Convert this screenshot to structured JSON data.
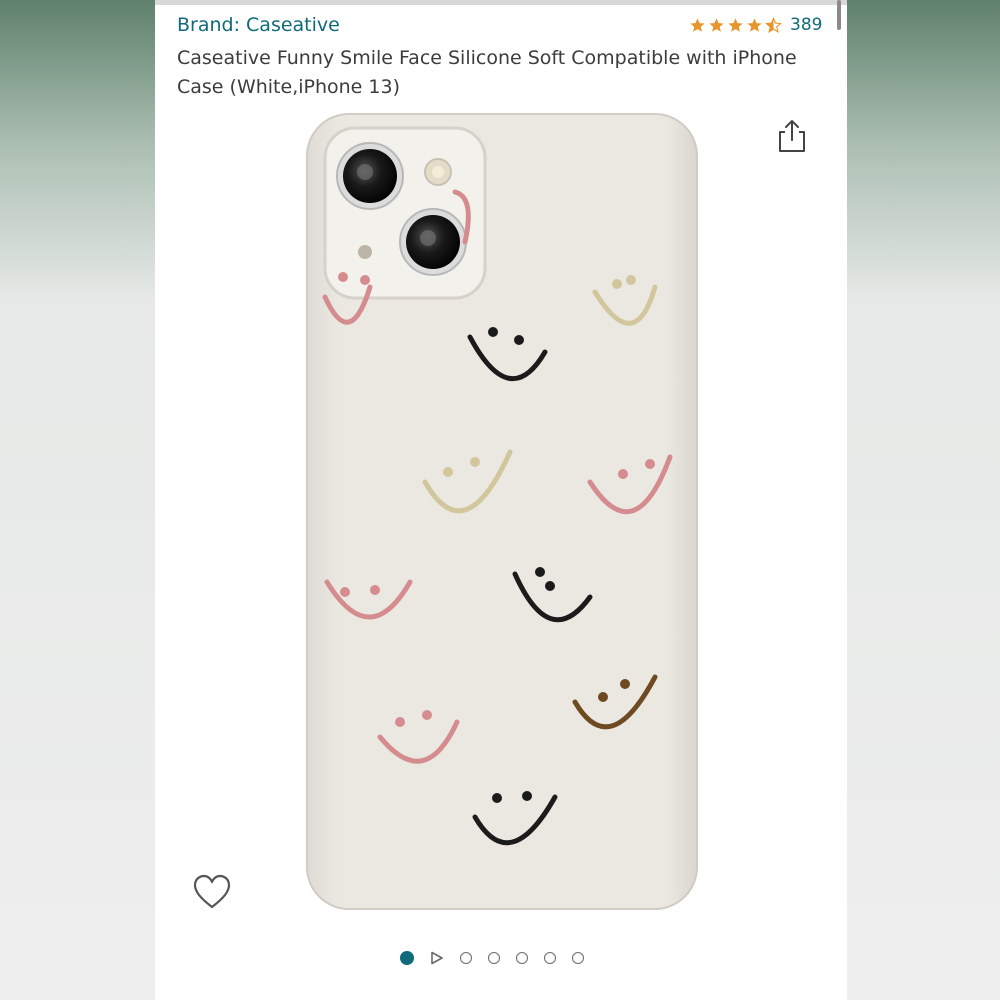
{
  "product": {
    "brand_label": "Brand: Caseative",
    "rating_value": 4.5,
    "rating_count": "389",
    "title": "Caseative Funny Smile Face Silicone Soft Compatible with iPhone Case (White,iPhone 13)"
  },
  "gallery": {
    "total_images": 6,
    "active_index": 0,
    "has_video": true
  },
  "colors": {
    "link": "#0f6a7a",
    "star": "#e8962b",
    "case": "#e9e6e0",
    "smile_pink": "#d58c8f",
    "smile_tan": "#d2c69c",
    "smile_black": "#1b1b1b",
    "smile_brown": "#6e4a22"
  },
  "icons": [
    "star-icon",
    "share-icon",
    "heart-icon",
    "play-icon"
  ]
}
